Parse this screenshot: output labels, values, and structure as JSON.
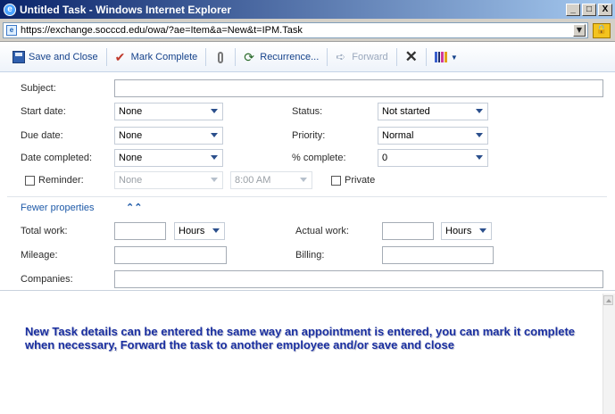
{
  "window": {
    "title": "Untitled Task - Windows Internet Explorer",
    "buttons": [
      "_",
      "□",
      "X"
    ]
  },
  "address": {
    "url": "https://exchange.socccd.edu/owa/?ae=Item&a=New&t=IPM.Task"
  },
  "toolbar": {
    "save_close": "Save and Close",
    "mark_complete": "Mark Complete",
    "recurrence": "Recurrence...",
    "forward": "Forward"
  },
  "form": {
    "subject_label": "Subject:",
    "subject_value": "",
    "start_date_label": "Start date:",
    "start_date_value": "None",
    "due_date_label": "Due date:",
    "due_date_value": "None",
    "date_completed_label": "Date completed:",
    "date_completed_value": "None",
    "status_label": "Status:",
    "status_value": "Not started",
    "priority_label": "Priority:",
    "priority_value": "Normal",
    "percent_label": "% complete:",
    "percent_value": "0",
    "reminder_label": "Reminder:",
    "reminder_date_value": "None",
    "reminder_time_value": "8:00 AM",
    "private_label": "Private",
    "fewer_properties": "Fewer properties",
    "total_work_label": "Total work:",
    "total_work_unit": "Hours",
    "actual_work_label": "Actual work:",
    "actual_work_unit": "Hours",
    "mileage_label": "Mileage:",
    "billing_label": "Billing:",
    "companies_label": "Companies:"
  },
  "annotation": {
    "text": "New Task details can be entered the same way an appointment is entered, you can mark it complete when necessary, Forward the task to another employee and/or save and close"
  },
  "colors": {
    "title_gradient_start": "#0a246a",
    "link_blue": "#1e5aa8",
    "annotation_blue": "#1a2fa0"
  }
}
